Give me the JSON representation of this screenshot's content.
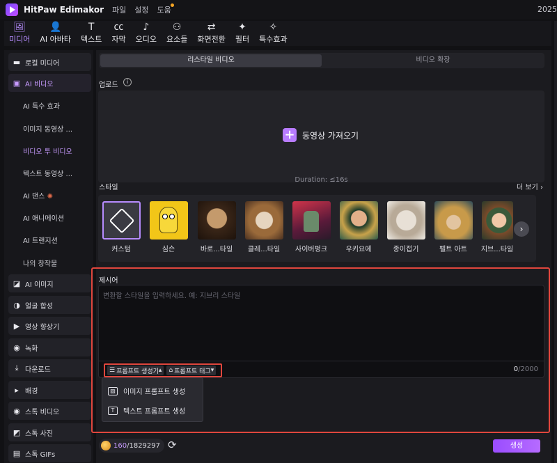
{
  "app": {
    "title": "HitPaw Edimakor",
    "menu": [
      "파일",
      "설정",
      "도움"
    ],
    "year": "2025"
  },
  "toolbar": [
    {
      "label": "미디어",
      "icon": "media-icon",
      "active": true
    },
    {
      "label": "AI 아바타",
      "icon": "avatar-icon"
    },
    {
      "label": "텍스트",
      "icon": "text-icon"
    },
    {
      "label": "자막",
      "icon": "cc-icon"
    },
    {
      "label": "오디오",
      "icon": "music-icon"
    },
    {
      "label": "요소들",
      "icon": "elements-icon"
    },
    {
      "label": "화면전환",
      "icon": "transition-icon"
    },
    {
      "label": "필터",
      "icon": "filter-icon"
    },
    {
      "label": "특수효과",
      "icon": "effects-icon"
    }
  ],
  "sidebar": {
    "items": [
      {
        "label": "로컬 미디어",
        "icon": "folder-icon"
      },
      {
        "label": "AI 비디오",
        "icon": "ai-video-icon",
        "active": true
      },
      {
        "label": "AI 특수 효과"
      },
      {
        "label": "이미지 동영상 ..."
      },
      {
        "label": "비디오 투 비디오",
        "active": true
      },
      {
        "label": "텍스트 동영상 ..."
      },
      {
        "label": "AI 댄스"
      },
      {
        "label": "AI 애니메이션"
      },
      {
        "label": "AI 트랜지션"
      },
      {
        "label": "나의 창작물"
      },
      {
        "label": "AI 이미지",
        "icon": "ai-image-icon"
      },
      {
        "label": "얼굴 합성",
        "icon": "face-swap-icon"
      },
      {
        "label": "영상 향상기",
        "icon": "enhancer-icon"
      },
      {
        "label": "녹화",
        "icon": "record-icon"
      },
      {
        "label": "다운로드",
        "icon": "download-icon"
      },
      {
        "label": "배경",
        "icon": "play-triangle-icon"
      },
      {
        "label": "스톡 비디오",
        "icon": "stock-video-icon"
      },
      {
        "label": "스톡 사진",
        "icon": "stock-photo-icon"
      },
      {
        "label": "스톡 GIFs",
        "icon": "gif-icon"
      }
    ]
  },
  "main": {
    "tabs": [
      "리스타일 비디오",
      "비디오 확장"
    ],
    "upload": {
      "label": "업로드",
      "button": "동영상 가져오기",
      "duration": "Duration: ≤16s"
    },
    "style": {
      "label": "스타일",
      "more": "더 보기",
      "items": [
        "커스텀",
        "심슨",
        "바로...타일",
        "클레...타일",
        "사이버펑크",
        "우키요에",
        "종이접기",
        "펠트 아트",
        "지브...타일"
      ]
    },
    "prompt": {
      "label": "제시어",
      "placeholder": "변환할 스타일을 입력하세요. 예: 지브리 스타일",
      "generator": "프롬프트 생성기",
      "tags": "프롬프트 태그",
      "count": "0",
      "max": "/2000",
      "dropdown": [
        "이미지 프롬프트  생성",
        "텍스트 프롬프트 생성"
      ]
    },
    "credits": {
      "used": "160",
      "total": "/1829297"
    },
    "generate": "생성"
  }
}
